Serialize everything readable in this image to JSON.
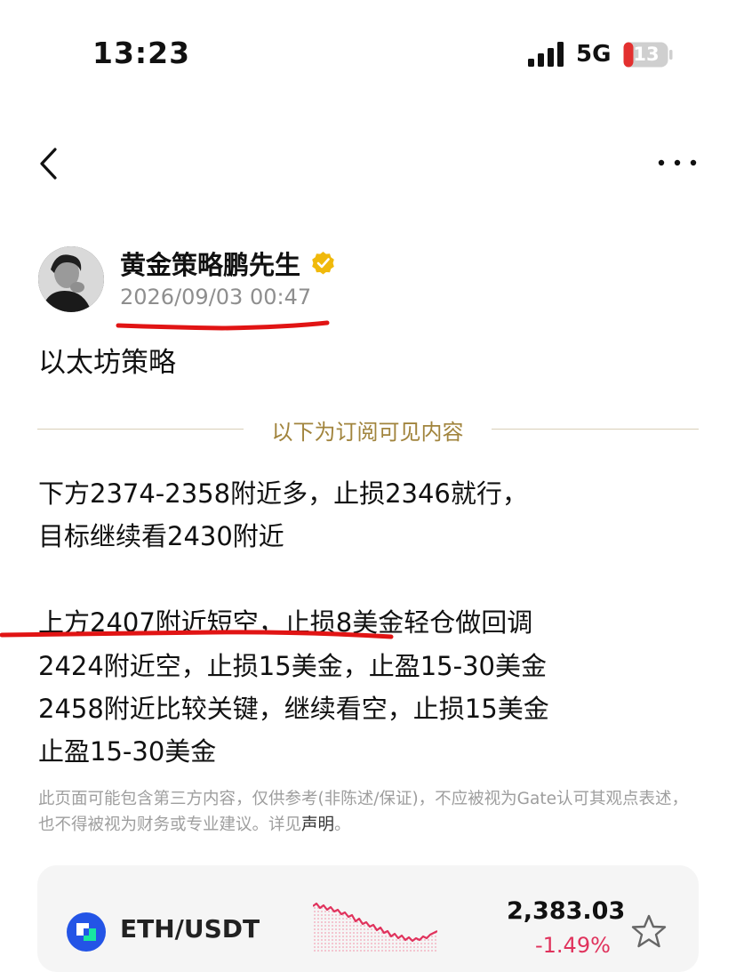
{
  "status_bar": {
    "time": "13:23",
    "network": "5G",
    "battery_level": "13"
  },
  "header": {
    "back_icon": "chevron-left-icon",
    "more_icon": "more-horizontal-icon"
  },
  "post": {
    "author": "黄金策略鹏先生",
    "verified_icon": "verified-badge-icon",
    "timestamp": "2026/09/03 00:47",
    "title": "以太坊策略",
    "subscription_divider": "以下为订阅可见内容",
    "lines": [
      "下方2374-2358附近多，止损2346就行，",
      "目标继续看2430附近",
      "上方2407附近短空，止损8美金轻仓做回调",
      "2424附近空，止损15美金，止盈15-30美金",
      "2458附近比较关键，继续看空，止损15美金",
      "止盈15-30美金"
    ],
    "disclaimer": "此页面可能包含第三方内容，仅供参考(非陈述/保证)，不应被视为Gate认可其观点表述，也不得被视为财务或专业建议。详见",
    "disclaimer_link": "声明",
    "disclaimer_end": "。"
  },
  "ticker_card": {
    "pair": "ETH/USDT",
    "price": "2,383.03",
    "change": "-1.49%",
    "sparkline_color": "#e0325c",
    "icon": "eth-coin-icon",
    "favorite_icon": "star-outline-icon"
  },
  "colors": {
    "annotation_red": "#e11414",
    "divider_gold": "#a1843d",
    "verified_gold": "#f0b90b"
  }
}
